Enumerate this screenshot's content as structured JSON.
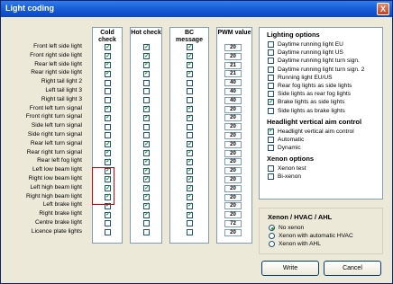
{
  "window": {
    "title": "Light coding",
    "close_symbol": "X"
  },
  "columns": {
    "cold": "Cold check",
    "hot": "Hot check",
    "bc": "BC message",
    "pwm": "PWM value"
  },
  "rows": [
    {
      "label": "Front left side light",
      "cold": true,
      "hot": true,
      "bc": true,
      "pwm": "20"
    },
    {
      "label": "Front right side light",
      "cold": true,
      "hot": true,
      "bc": true,
      "pwm": "20"
    },
    {
      "label": "Rear left side light",
      "cold": true,
      "hot": true,
      "bc": true,
      "pwm": "21"
    },
    {
      "label": "Rear right side light",
      "cold": true,
      "hot": true,
      "bc": true,
      "pwm": "21"
    },
    {
      "label": "Right tail light 2",
      "cold": false,
      "hot": false,
      "bc": false,
      "pwm": "40"
    },
    {
      "label": "Left tail light 3",
      "cold": false,
      "hot": false,
      "bc": false,
      "pwm": "40"
    },
    {
      "label": "Right tail light 3",
      "cold": false,
      "hot": false,
      "bc": false,
      "pwm": "40"
    },
    {
      "label": "Front left turn signal",
      "cold": true,
      "hot": true,
      "bc": true,
      "pwm": "20"
    },
    {
      "label": "Front right turn signal",
      "cold": true,
      "hot": true,
      "bc": true,
      "pwm": "20"
    },
    {
      "label": "Side left turn signal",
      "cold": false,
      "hot": false,
      "bc": false,
      "pwm": "20"
    },
    {
      "label": "Side right turn signal",
      "cold": false,
      "hot": false,
      "bc": false,
      "pwm": "20"
    },
    {
      "label": "Rear left turn signal",
      "cold": true,
      "hot": true,
      "bc": true,
      "pwm": "20"
    },
    {
      "label": "Rear right turn signal",
      "cold": true,
      "hot": true,
      "bc": true,
      "pwm": "20"
    },
    {
      "label": "Rear left fog light",
      "cold": true,
      "hot": true,
      "bc": true,
      "pwm": "20"
    },
    {
      "label": "Left low beam light",
      "cold": true,
      "hot": true,
      "bc": true,
      "pwm": "20"
    },
    {
      "label": "Right low beam light",
      "cold": true,
      "hot": true,
      "bc": true,
      "pwm": "20"
    },
    {
      "label": "Left high beam light",
      "cold": true,
      "hot": true,
      "bc": true,
      "pwm": "20"
    },
    {
      "label": "Right high beam light",
      "cold": true,
      "hot": true,
      "bc": true,
      "pwm": "20"
    },
    {
      "label": "Left brake light",
      "cold": true,
      "hot": true,
      "bc": true,
      "pwm": "20"
    },
    {
      "label": "Right brake light",
      "cold": true,
      "hot": true,
      "bc": true,
      "pwm": "20"
    },
    {
      "label": "Centre brake light",
      "cold": false,
      "hot": false,
      "bc": false,
      "pwm": "72"
    },
    {
      "label": "Licence plate lights",
      "cold": false,
      "hot": false,
      "bc": false,
      "pwm": "20"
    }
  ],
  "lighting_options": {
    "heading": "Lighting options",
    "items": [
      {
        "label": "Daytime running light EU",
        "checked": false
      },
      {
        "label": "Daytime running light US",
        "checked": false
      },
      {
        "label": "Daytime running light turn sign.",
        "checked": false
      },
      {
        "label": "Daytime running light turn sign. 2",
        "checked": false
      },
      {
        "label": "Running light EU/US",
        "checked": false
      },
      {
        "label": "Rear fog lights as side lights",
        "checked": false
      },
      {
        "label": "Side lights as rear fog lights",
        "checked": false
      },
      {
        "label": "Brake lights as side lights",
        "checked": true
      },
      {
        "label": "Side lights as brake lights",
        "checked": false
      }
    ]
  },
  "headlight_aim": {
    "heading": "Headlight vertical aim control",
    "items": [
      {
        "label": "Headlight vertical aim control",
        "checked": true
      },
      {
        "label": "Automatic",
        "checked": false
      },
      {
        "label": "Dynamic",
        "checked": false
      }
    ]
  },
  "xenon_options": {
    "heading": "Xenon options",
    "items": [
      {
        "label": "Xenon test",
        "checked": false
      },
      {
        "label": "Bi-xenon",
        "checked": false
      }
    ]
  },
  "xenon_hvac": {
    "heading": "Xenon / HVAC / AHL",
    "items": [
      {
        "label": "No xenon",
        "selected": true
      },
      {
        "label": "Xenon with automatic HVAC",
        "selected": false
      },
      {
        "label": "Xenon with AHL",
        "selected": false
      }
    ]
  },
  "buttons": {
    "write": "Write",
    "cancel": "Cancel"
  }
}
